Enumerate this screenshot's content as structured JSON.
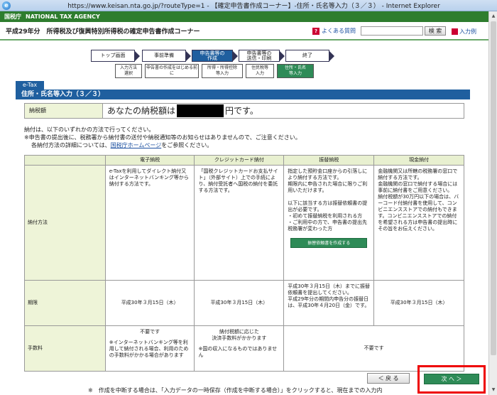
{
  "window": {
    "title": "https://www.keisan.nta.go.jp/?routeType=1 - 【確定申告書作成コーナー】-住所・氏名等入力（３／３） - Internet Explorer"
  },
  "site": {
    "agency_ja": "国税庁",
    "agency_en": "NATIONAL TAX AGENCY",
    "corner_title": "平成29年分　所得税及び復興特別所得税の確定申告書作成コーナー",
    "faq_label": "よくある質問",
    "search_label": "検 索",
    "guide_label": "入力例"
  },
  "steps": [
    {
      "label": "トップ画面"
    },
    {
      "label": "事前準備"
    },
    {
      "label": "申告書等の\n作成"
    },
    {
      "label": "申告書等の\n送信・印刷"
    },
    {
      "label": "終了"
    }
  ],
  "substeps": [
    {
      "label": "入力方法\n選択"
    },
    {
      "label": "申告書の作成をはじめる前に"
    },
    {
      "label": "所得・所得控除\n等入力"
    },
    {
      "label": "住民税等\n入力"
    },
    {
      "label": "住所・氏名\n等入力"
    }
  ],
  "etax_label": "e-Tax",
  "page_title": "住所・氏名等入力（３／３）",
  "tax": {
    "label": "納税額",
    "text_before": "あなたの納税額は",
    "text_after": "円です。"
  },
  "notes": {
    "line1": "納付は、以下のいずれかの方法で行ってください。",
    "line2": "※申告書の提出後に、税務署から納付書の送付や納税通知等のお知らせはありませんので、ご注意ください。",
    "line3_before": "各納付方法の詳細については、",
    "line3_link": "国税庁ホームページ",
    "line3_after": "をご参照ください。"
  },
  "table": {
    "headers": [
      "電子納税",
      "クレジットカード納付",
      "振替納税",
      "現金納付"
    ],
    "row_method_label": "納付方法",
    "method": [
      "e-Taxを利用してダイレクト納付又はインターネットバンキング等から納付する方法です。",
      "「国税クレジットカードお支払サイト」（外部サイト）上での手続により、納付受託者へ国税の納付を委託する方法です。",
      "指定した預貯金口座からの引落しにより納付する方法です。\n期限内に申告された場合に限りご利用いただけます。\n\n以下に該当する方は振替依頼書の提出が必要です。\n・初めて振替納税を利用される方\n・ご利用中の方で、申告書の提出先税務署が変わった方",
      "金融機関又は所轄の税務署の窓口で納付する方法です。\n金融機関の窓口で納付する場合には事前に納付書をご用意ください。\n納付税額が30万円以下の場合は、バーコード付納付書を使用して、コンビニエンスストアでの納付もできます。コンビニエンスストアでの納付を希望される方は申告書の提出時にその旨をお伝えください。"
    ],
    "furikae_button": "振替依頼書を作成する",
    "row_deadline_label": "期限",
    "deadline": [
      "平成30年３月15日（木）",
      "平成30年３月15日（木）",
      "平成30年３月15日（木）までに振替依頼書を提出してください。\n平成29年分の期間内申告分の振替日は、平成30年４月20日（金）です。",
      "平成30年３月15日（木）"
    ],
    "row_fee_label": "手数料",
    "fee_etax_1": "不要です",
    "fee_etax_2": "※インターネットバンキング等を利用して納付される場合、利用のための手数料がかかる場合があります",
    "fee_credit_1": "納付税額に応じた\n決済手数料がかかります",
    "fee_credit_2": "※国の収入になるものではありません",
    "fee_other": "不要です"
  },
  "buttons": {
    "back": "＜ 戻 る",
    "next": "次 へ ＞"
  },
  "footer_note": "※　作成を中断する場合は、「入力データの一時保存（作成を中断する場合）」をクリックすると、現在までの入力内"
}
